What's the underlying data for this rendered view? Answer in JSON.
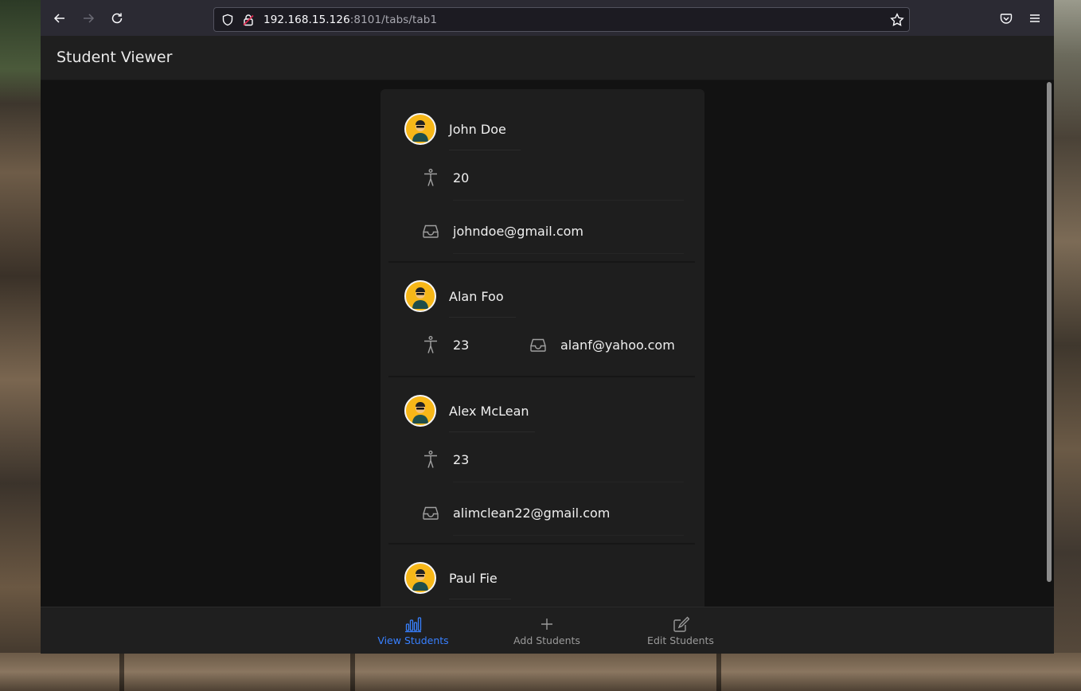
{
  "browser": {
    "url_host": "192.168.15.126",
    "url_rest": ":8101/tabs/tab1"
  },
  "app": {
    "title": "Student Viewer"
  },
  "students": [
    {
      "name": "John Doe",
      "age": "20",
      "email": "johndoe@gmail.com"
    },
    {
      "name": "Alan Foo",
      "age": "23",
      "email": "alanf@yahoo.com"
    },
    {
      "name": "Alex McLean",
      "age": "23",
      "email": "alimclean22@gmail.com"
    },
    {
      "name": "Paul Fie"
    }
  ],
  "tabs": [
    {
      "label": "View Students",
      "icon": "bar-chart-icon",
      "active": true
    },
    {
      "label": "Add Students",
      "icon": "plus-icon",
      "active": false
    },
    {
      "label": "Edit Students",
      "icon": "edit-icon",
      "active": false
    }
  ],
  "colors": {
    "accent": "#3880ff",
    "avatar_bg": "#f7b718",
    "background": "#121212",
    "card": "#1e1e1e"
  }
}
